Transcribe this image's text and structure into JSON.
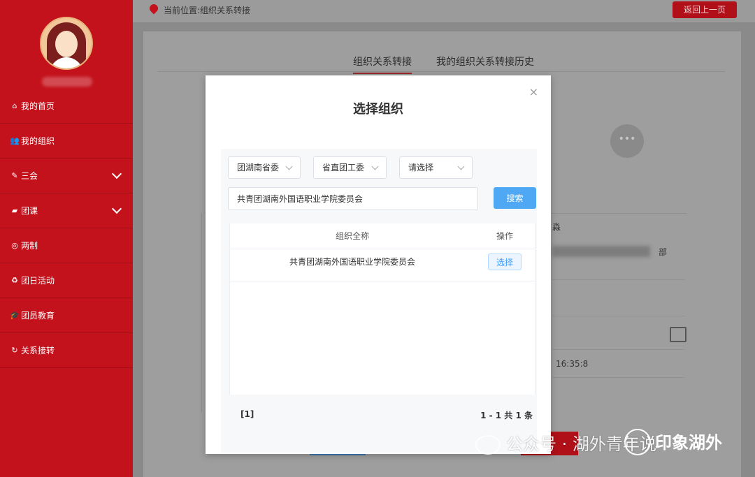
{
  "sidebar": {
    "items": [
      {
        "icon": "home-icon",
        "glyph": "⌂",
        "label": "我的首页",
        "expandable": false
      },
      {
        "icon": "users-icon",
        "glyph": "👥",
        "label": "我的组织",
        "expandable": false
      },
      {
        "icon": "edit-icon",
        "glyph": "✎",
        "label": "三会",
        "expandable": true
      },
      {
        "icon": "folder-icon",
        "glyph": "▰",
        "label": "团课",
        "expandable": true
      },
      {
        "icon": "target-icon",
        "glyph": "◎",
        "label": "两制",
        "expandable": false
      },
      {
        "icon": "recycle-icon",
        "glyph": "♻",
        "label": "团日活动",
        "expandable": false
      },
      {
        "icon": "graduation-cap-icon",
        "glyph": "🎓",
        "label": "团员教育",
        "expandable": false
      },
      {
        "icon": "refresh-icon",
        "glyph": "↻",
        "label": "关系接转",
        "expandable": false
      }
    ]
  },
  "header": {
    "location": "当前位置:组织关系转接",
    "back_label": "返回上一页"
  },
  "tabs": [
    {
      "label": "组织关系转接",
      "active": true
    },
    {
      "label": "我的组织关系转接历史",
      "active": false
    }
  ],
  "background": {
    "field_a": "淼",
    "field_b": "部",
    "time": "16:35:8"
  },
  "modal": {
    "title": "选择组织",
    "close": "×",
    "selects": [
      "团湖南省委",
      "省直团工委",
      "请选择"
    ],
    "search_value": "共青团湖南外国语职业学院委员会",
    "search_button": "搜索",
    "table": {
      "headers": [
        "组织全称",
        "操作"
      ],
      "rows": [
        {
          "name": "共青团湖南外国语职业学院委员会",
          "action": "选择"
        }
      ]
    },
    "pagination": {
      "pages": "[1]",
      "summary": "1 - 1   共 1 条"
    }
  },
  "watermark": {
    "text": "公众号 · 湖外青年说",
    "logo_text": "印象湖外"
  },
  "colors": {
    "sidebar_red": "#c4121c",
    "primary_blue": "#4ea8f3",
    "link_blue": "#409eff"
  }
}
